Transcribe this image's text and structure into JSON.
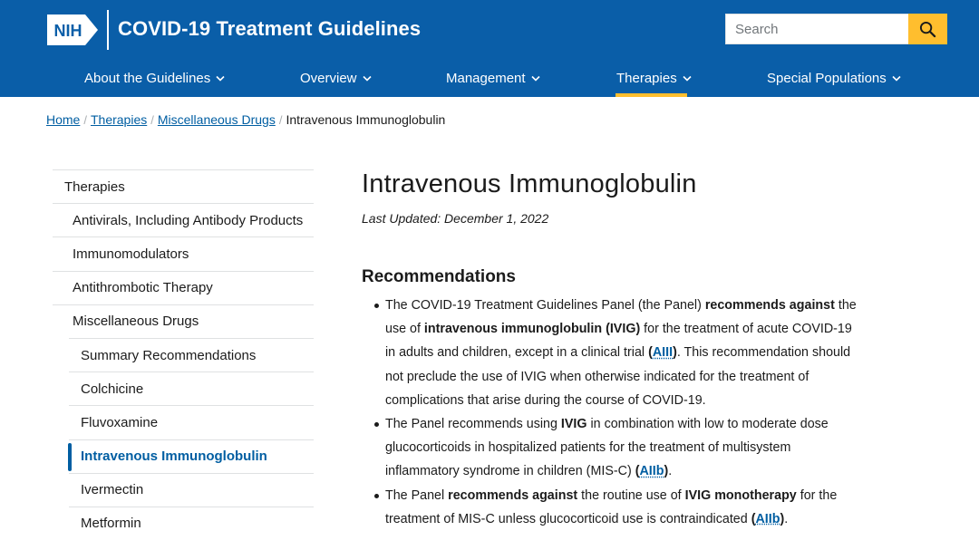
{
  "header": {
    "logo_text": "NIH",
    "site_title": "COVID-19 Treatment Guidelines",
    "search_placeholder": "Search",
    "search_icon": "search-icon",
    "colors": {
      "header_bg": "#0a5ea8",
      "accent": "#ffbe2e",
      "link": "#005ea2"
    }
  },
  "nav": {
    "items": [
      {
        "label": "About the Guidelines"
      },
      {
        "label": "Overview"
      },
      {
        "label": "Management"
      },
      {
        "label": "Therapies",
        "active": true
      },
      {
        "label": "Special Populations"
      }
    ]
  },
  "breadcrumb": {
    "items": [
      "Home",
      "Therapies",
      "Miscellaneous Drugs"
    ],
    "current": "Intravenous Immunoglobulin",
    "separator": "/"
  },
  "sidebar": {
    "items": [
      {
        "label": "Therapies",
        "level": 0
      },
      {
        "label": "Antivirals, Including Antibody Products",
        "level": 1
      },
      {
        "label": "Immunomodulators",
        "level": 1
      },
      {
        "label": "Antithrombotic Therapy",
        "level": 1
      },
      {
        "label": "Miscellaneous Drugs",
        "level": 1
      },
      {
        "label": "Summary Recommendations",
        "level": 2
      },
      {
        "label": "Colchicine",
        "level": 2
      },
      {
        "label": "Fluvoxamine",
        "level": 2
      },
      {
        "label": "Intravenous Immunoglobulin",
        "level": 2,
        "active": true
      },
      {
        "label": "Ivermectin",
        "level": 2
      },
      {
        "label": "Metformin",
        "level": 2
      }
    ]
  },
  "main": {
    "title": "Intravenous Immunoglobulin",
    "last_updated": "Last Updated: December 1, 2022",
    "section_heading": "Recommendations",
    "recommendations": [
      {
        "t1": "The COVID-19 Treatment Guidelines Panel (the Panel) ",
        "b1": "recommends against",
        "t2": " the use of ",
        "b2": "intravenous immunoglobulin (IVIG)",
        "t3": " for the treatment of acute COVID-19 in adults and children, except in a clinical trial ",
        "rating_open": "(",
        "rating": "AIII",
        "rating_close": ")",
        "t4": ". This recommendation should not preclude the use of IVIG when otherwise indicated for the treatment of complications that arise during the course of COVID-19."
      },
      {
        "t1": "The Panel recommends using ",
        "b1": "IVIG",
        "t2": " in combination with low to moderate dose glucocorticoids in hospitalized patients for the treatment of multisystem inflammatory syndrome in children (MIS-C) ",
        "rating_open": "(",
        "rating": "AIIb",
        "rating_close": ")",
        "t3": "."
      },
      {
        "t1": "The Panel ",
        "b1": "recommends against",
        "t2": " the routine use of ",
        "b2": "IVIG monotherapy",
        "t3": " for the treatment of MIS-C unless glucocorticoid use is contraindicated ",
        "rating_open": "(",
        "rating": "AIIb",
        "rating_close": ")",
        "t4": "."
      }
    ]
  }
}
